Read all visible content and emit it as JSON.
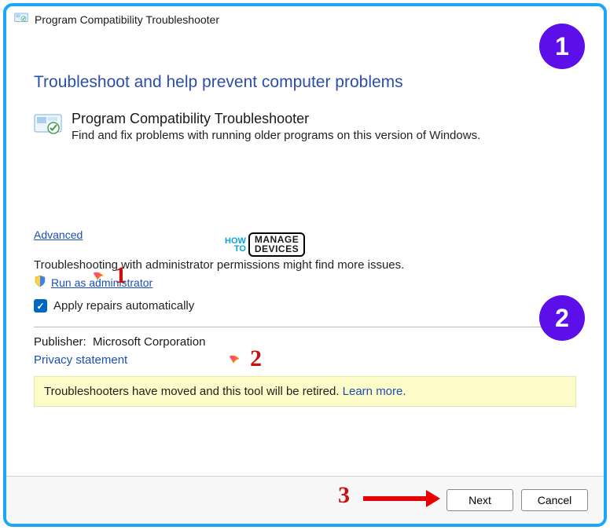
{
  "titlebar": {
    "title": "Program Compatibility Troubleshooter"
  },
  "heading": "Troubleshoot and help prevent computer problems",
  "troubleshooter": {
    "title": "Program Compatibility Troubleshooter",
    "desc": "Find and fix problems with running older programs on this version of Windows."
  },
  "links": {
    "advanced": "Advanced",
    "run_as_admin": "Run as administrator",
    "privacy": "Privacy statement",
    "learn_more": "Learn more."
  },
  "admin_note": "Troubleshooting with administrator permissions might find more issues.",
  "checkbox": {
    "apply_repairs": "Apply repairs automatically",
    "checked": true
  },
  "publisher": {
    "label": "Publisher:",
    "value": "Microsoft Corporation"
  },
  "notice": "Troubleshooters have moved and this tool will be retired.",
  "buttons": {
    "next": "Next",
    "cancel": "Cancel"
  },
  "watermark": {
    "line1": "HOW",
    "line2": "TO",
    "box1": "MANAGE",
    "box2": "DEVICES"
  },
  "annotations": {
    "badge1": "1",
    "badge2": "2",
    "step1": "1",
    "step2": "2",
    "step3": "3"
  }
}
